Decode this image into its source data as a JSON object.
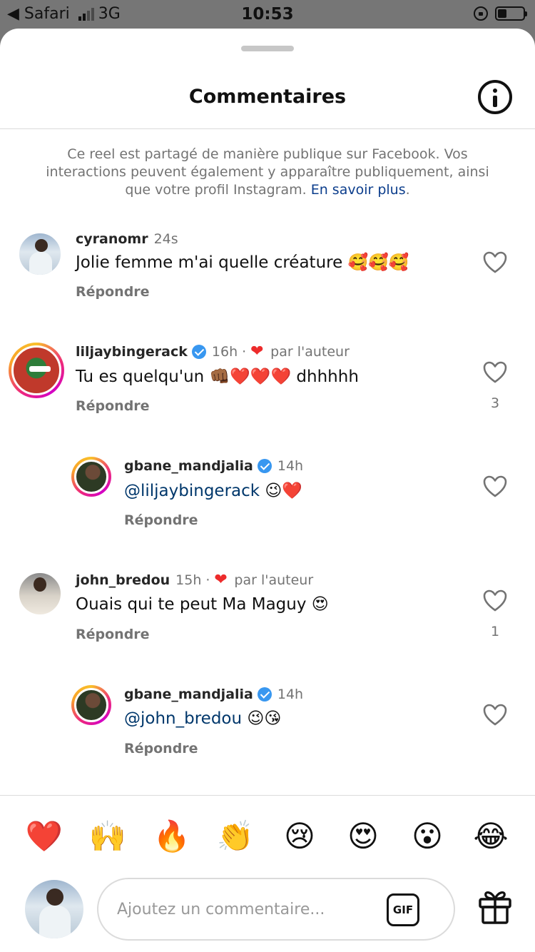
{
  "status_bar": {
    "back_app": "◀ Safari",
    "network": "3G",
    "time": "10:53"
  },
  "header": {
    "title": "Commentaires"
  },
  "notice": {
    "text": "Ce reel est partagé de manière publique sur Facebook. Vos interactions peuvent également y apparaître publiquement, ainsi que votre profil Instagram.",
    "link": "En savoir plus"
  },
  "comments": [
    {
      "username": "cyranomr",
      "time": "24s",
      "text": "Jolie femme m'ai quelle créature 🥰🥰🥰",
      "reply": "Répondre"
    },
    {
      "username": "liljaybingerack",
      "time": "16h",
      "author_like": "par l'auteur",
      "text": "Tu es quelqu'un 👊🏾❤️❤️❤️ dhhhhh",
      "reply": "Répondre",
      "likes": "3"
    },
    {
      "username": "gbane_mandjalia",
      "time": "14h",
      "mention": "@liljaybingerack",
      "text": "😉❤️",
      "reply": "Répondre"
    },
    {
      "username": "john_bredou",
      "time": "15h",
      "author_like": "par l'auteur",
      "text": "Ouais qui te peut Ma Maguy 😍",
      "reply": "Répondre",
      "likes": "1"
    },
    {
      "username": "gbane_mandjalia",
      "time": "14h",
      "mention": "@john_bredou",
      "text": "😉😘",
      "reply": "Répondre"
    }
  ],
  "reactions": [
    "❤️",
    "🙌",
    "🔥",
    "👏",
    "😢",
    "😍",
    "😮",
    "😂"
  ],
  "composer": {
    "placeholder": "Ajoutez un commentaire...",
    "gif_label": "GIF"
  },
  "colors": {
    "link": "#0b3d8c",
    "mention": "#00376b",
    "secondary_text": "#737373",
    "heart_red": "#ed2b2b",
    "verified": "#3897f0"
  },
  "icons": [
    "info-icon",
    "heart-outline-icon",
    "verified-badge-icon",
    "gif-icon",
    "gift-icon"
  ]
}
